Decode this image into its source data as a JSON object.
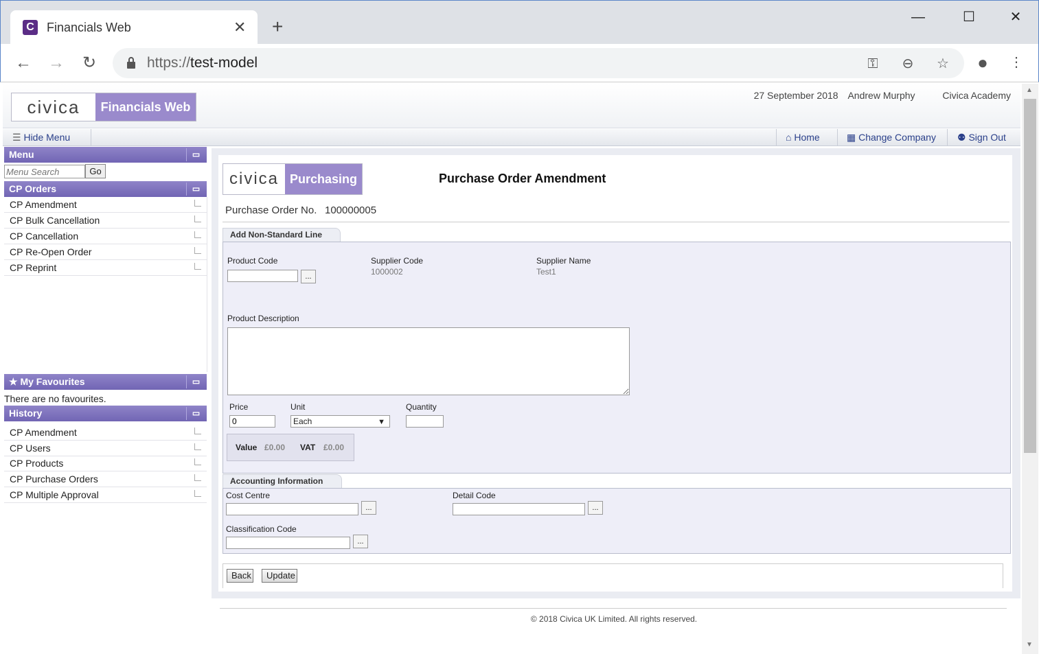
{
  "browser": {
    "tab_title": "Financials Web",
    "tab_favicon": "C",
    "url_scheme": "https://",
    "url_host": "test-model"
  },
  "header": {
    "logo_brand": "civica",
    "logo_app": "Financials Web",
    "date": "27 September 2018",
    "user": "Andrew Murphy",
    "company": "Civica Academy"
  },
  "menubar": {
    "hide_menu": "Hide Menu",
    "home": "Home",
    "change_company": "Change Company",
    "sign_out": "Sign Out"
  },
  "sidebar": {
    "menu_title": "Menu",
    "search_placeholder": "Menu Search",
    "go_label": "Go",
    "cp_orders_title": "CP Orders",
    "cp_orders": [
      "CP Amendment",
      "CP Bulk Cancellation",
      "CP Cancellation",
      "CP Re-Open Order",
      "CP Reprint"
    ],
    "favourites_title": "My Favourites",
    "favourites_empty": "There are no favourites.",
    "history_title": "History",
    "history": [
      "CP Amendment",
      "CP Users",
      "CP Products",
      "CP Purchase Orders",
      "CP Multiple Approval"
    ]
  },
  "form": {
    "logo_brand": "civica",
    "logo_app": "Purchasing",
    "title": "Purchase Order Amendment",
    "po_label": "Purchase Order No.",
    "po_value": "100000005",
    "section1_title": "Add Non-Standard Line",
    "product_code_label": "Product Code",
    "supplier_code_label": "Supplier Code",
    "supplier_code_value": "1000002",
    "supplier_name_label": "Supplier Name",
    "supplier_name_value": "Test1",
    "product_description_label": "Product Description",
    "price_label": "Price",
    "price_value": "0",
    "unit_label": "Unit",
    "unit_value": "Each",
    "quantity_label": "Quantity",
    "value_label": "Value",
    "value_amount": "£0.00",
    "vat_label": "VAT",
    "vat_amount": "£0.00",
    "section2_title": "Accounting Information",
    "cost_centre_label": "Cost Centre",
    "detail_code_label": "Detail Code",
    "classification_code_label": "Classification Code",
    "lookup_label": "...",
    "back_label": "Back",
    "update_label": "Update"
  },
  "footer": "© 2018 Civica UK Limited. All rights reserved."
}
